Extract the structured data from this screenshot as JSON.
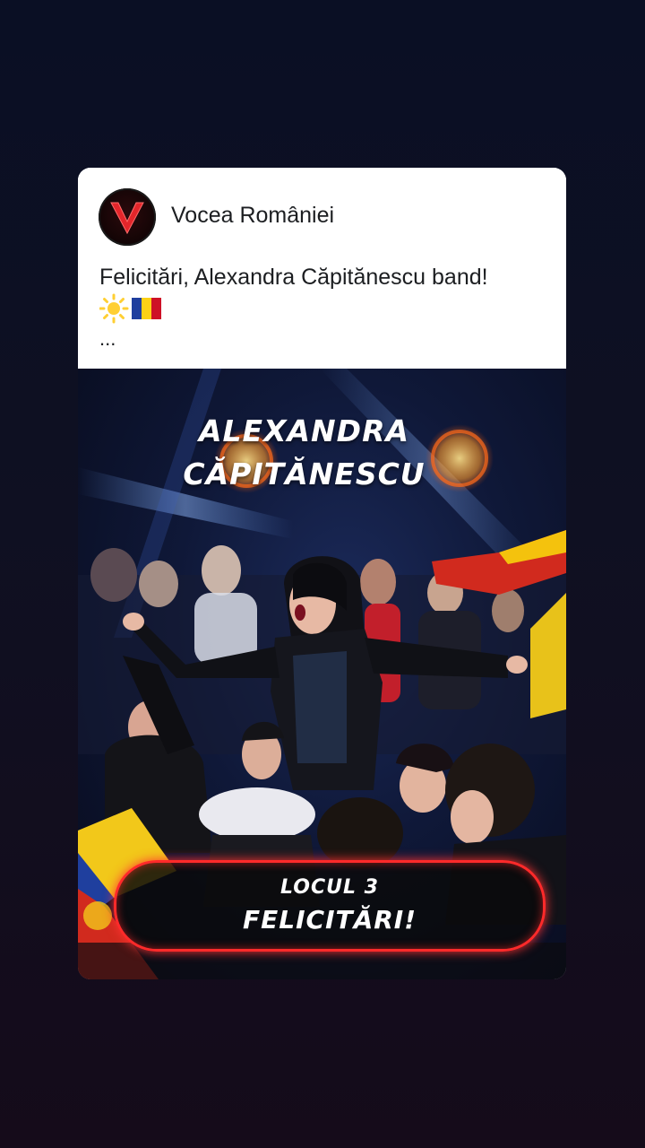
{
  "post": {
    "page_name": "Vocea României",
    "caption": "Felicitări, Alexandra Căpitănescu band!",
    "emojis": [
      "sun-emoji",
      "romania-flag-emoji"
    ],
    "more_label": "..."
  },
  "photo": {
    "name_line1": "ALEXANDRA",
    "name_line2": "CĂPITĂNESCU",
    "badge_top": "LOCUL 3",
    "badge_main": "FELICITĂRI!"
  },
  "colors": {
    "accent_red": "#ff2a2a",
    "background_top": "#0a0f24",
    "background_bottom": "#150b1a"
  }
}
